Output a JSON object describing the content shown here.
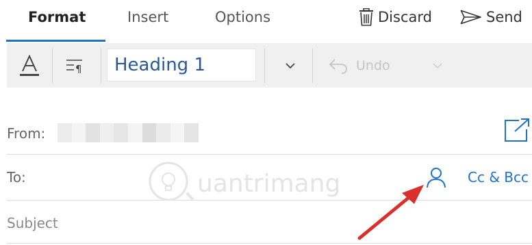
{
  "tabs": [
    {
      "label": "Format",
      "active": true
    },
    {
      "label": "Insert",
      "active": false
    },
    {
      "label": "Options",
      "active": false
    }
  ],
  "commands": {
    "discard": {
      "label": "Discard",
      "icon": "trash-icon"
    },
    "send": {
      "label": "Send",
      "icon": "send-icon"
    }
  },
  "toolbar": {
    "font_icon": "font-format-icon",
    "paragraph_icon": "paragraph-format-icon",
    "style_value": "Heading 1",
    "undo_label": "Undo"
  },
  "fields": {
    "from_label": "From:",
    "to_label": "To:",
    "cc_bcc_label": "Cc & Bcc",
    "subject_placeholder": "Subject"
  },
  "watermark": {
    "text": "uantrimang"
  },
  "colors": {
    "accent": "#1f72c9",
    "heading_text": "#2b5797",
    "annotation_arrow": "#d9302c",
    "toolbar_bg": "#f0f0f0"
  }
}
